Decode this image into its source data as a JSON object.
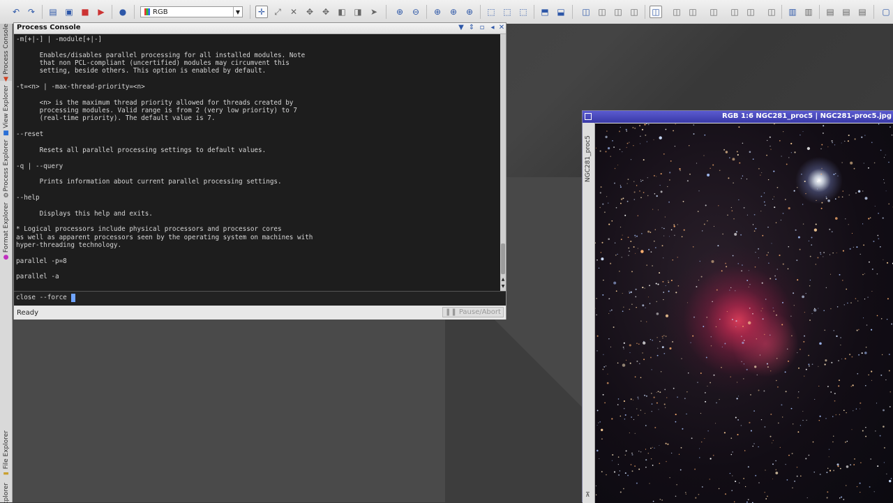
{
  "toolbar": {
    "color_mode": "RGB"
  },
  "left_dock": {
    "tabs": [
      "Process Console",
      "View Explorer",
      "Process Explorer",
      "Format Explorer",
      "File Explorer",
      "Explorer"
    ]
  },
  "console": {
    "title": "Process Console",
    "output": "-m[+|-] | -module[+|-]\n\n      Enables/disables parallel processing for all installed modules. Note\n      that non PCL-compliant (uncertified) modules may circumvent this\n      setting, beside others. This option is enabled by default.\n\n-t=<n> | -max-thread-priority=<n>\n\n      <n> is the maximum thread priority allowed for threads created by\n      processing modules. Valid range is from 2 (very low priority) to 7\n      (real-time priority). The default value is 7.\n\n--reset\n\n      Resets all parallel processing settings to default values.\n\n-q | --query\n\n      Prints information about current parallel processing settings.\n\n--help\n\n      Displays this help and exits.\n\n* Logical processors include physical processors and processor cores\nas well as apparent processors seen by the operating system on machines with\nhyper-threading technology.\n\nparallel -p=8\n\nparallel -a",
    "input": "close --force ",
    "status": "Ready",
    "pause_label": "Pause/Abort"
  },
  "image_window": {
    "title": "RGB 1:6 NGC281_proc5 | NGC281-proc5.jpg",
    "side_label": "NGC281_proc5"
  },
  "colors": {
    "console_bg": "#1d1d1d",
    "console_text": "#d6d6d6",
    "image_titlebar": "#3a3aa8",
    "caret": "#6fa4ff"
  }
}
